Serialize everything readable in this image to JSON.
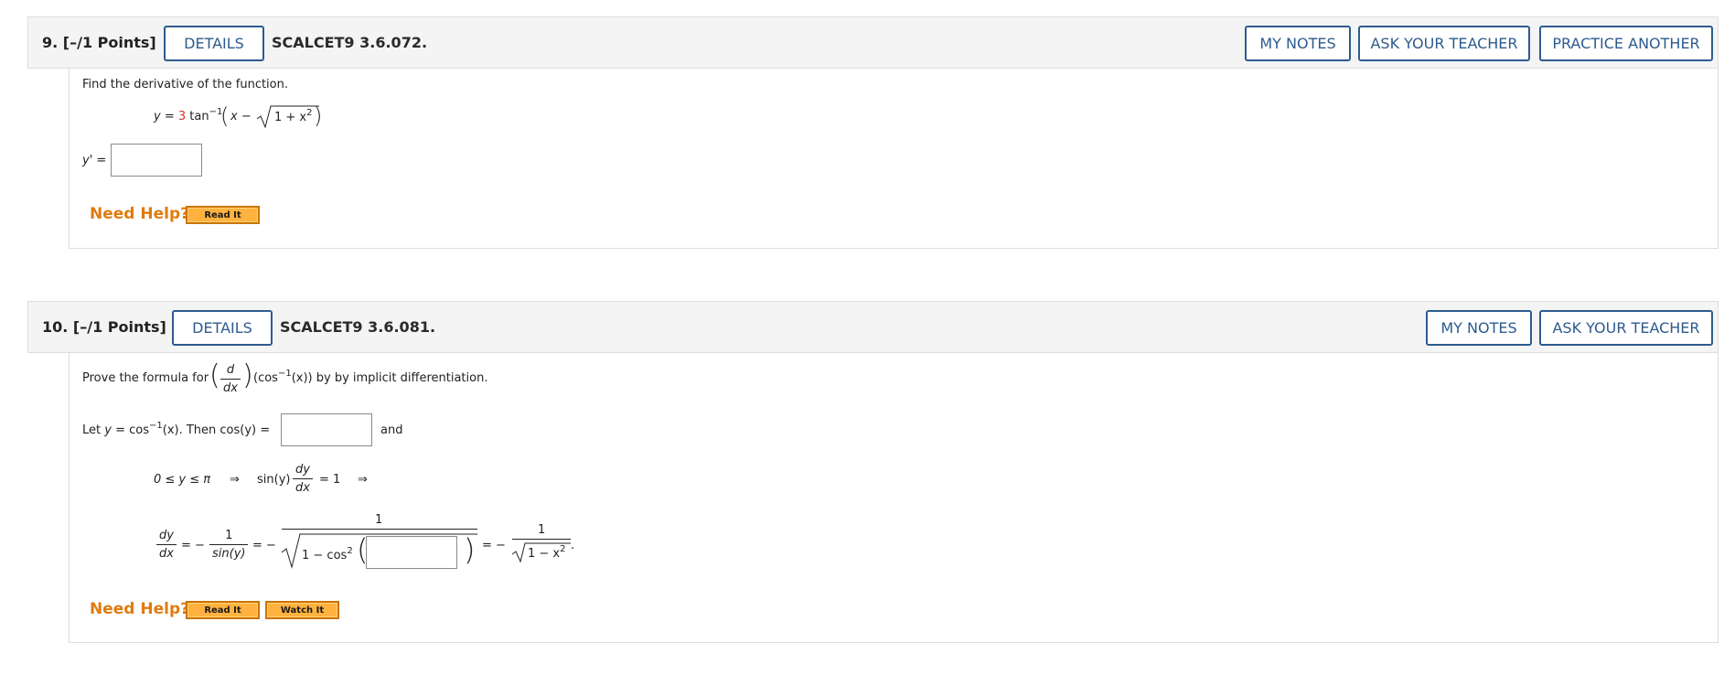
{
  "questions": [
    {
      "number": "9.",
      "points": "[–/1 Points]",
      "details_label": "DETAILS",
      "code": "SCALCET9 3.6.072.",
      "buttons": {
        "my_notes": "MY NOTES",
        "ask_teacher": "ASK YOUR TEACHER",
        "practice_another": "PRACTICE ANOTHER"
      },
      "prompt": "Find the derivative of the function.",
      "function": {
        "lhs": "y =",
        "coef": "3",
        "fn": "tan",
        "exp": "−1",
        "inner_start": "x −",
        "radicand": "1 + x",
        "radicand_exp": "2"
      },
      "answer_label": "y' =",
      "answer_value": "",
      "need_help": "Need Help?",
      "help_buttons": [
        "Read It"
      ]
    },
    {
      "number": "10.",
      "points": "[–/1 Points]",
      "details_label": "DETAILS",
      "code": "SCALCET9 3.6.081.",
      "buttons": {
        "my_notes": "MY NOTES",
        "ask_teacher": "ASK YOUR TEACHER"
      },
      "prompt_start": "Prove the formula for",
      "prompt_d": "d",
      "prompt_dx": "dx",
      "prompt_cos": "(cos",
      "prompt_cos_exp": "−1",
      "prompt_end": "(x)) by by implicit differentiation.",
      "let_text_start": "Let",
      "let_y": "y",
      "let_eq": "= cos",
      "let_exp": "−1",
      "let_x": "(x). Then cos(y) =",
      "let_and": "and",
      "answer1_value": "",
      "line2": {
        "range": "0 ≤ y ≤ π",
        "arrow1": "⇒",
        "sin": "sin(y)",
        "dy": "dy",
        "dx": "dx",
        "eq1": "= 1",
        "arrow2": "⇒"
      },
      "line3": {
        "dy": "dy",
        "dx": "dx",
        "eq_minus": "= −",
        "one": "1",
        "sin": "sin(y)",
        "eq_minus2": "= −",
        "num1": "1",
        "rad_text": "1 − cos",
        "rad_exp": "2",
        "eq_minus3": "= −",
        "num2": "1",
        "rad2_text": "1 − x",
        "rad2_exp": "2",
        "period": "."
      },
      "answer2_value": "",
      "need_help": "Need Help?",
      "help_buttons": [
        "Read It",
        "Watch It"
      ]
    }
  ]
}
